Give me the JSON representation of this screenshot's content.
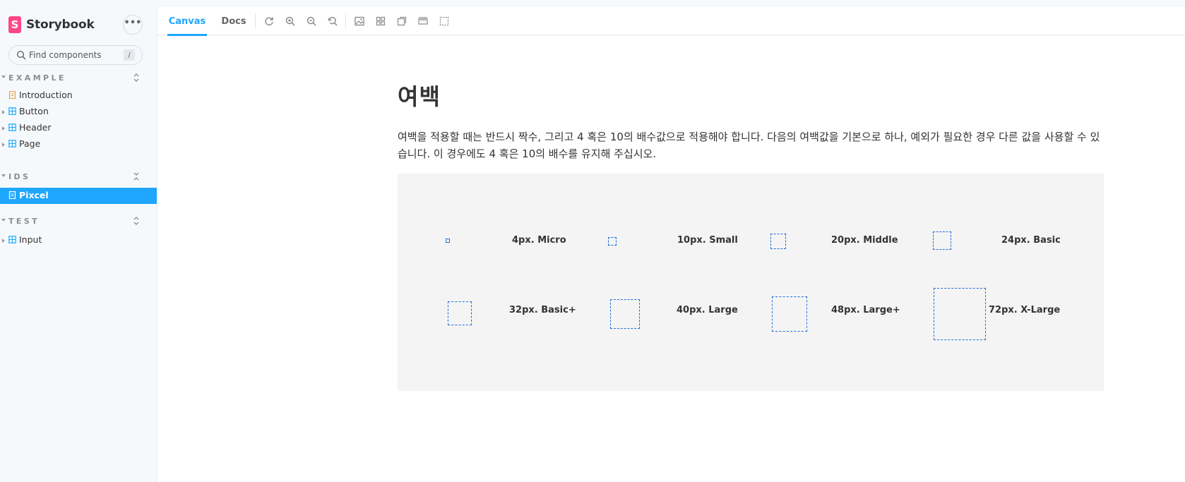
{
  "sidebar": {
    "brand": "Storybook",
    "brand_mark": "S",
    "menu_label": "•••",
    "search": {
      "placeholder": "Find components",
      "shortcut": "/"
    },
    "groups": [
      {
        "title": "EXAMPLE",
        "items": [
          {
            "label": "Introduction",
            "icon": "document-icon",
            "expandable": false
          },
          {
            "label": "Button",
            "icon": "component-icon",
            "expandable": true
          },
          {
            "label": "Header",
            "icon": "component-icon",
            "expandable": true
          },
          {
            "label": "Page",
            "icon": "component-icon",
            "expandable": true
          }
        ]
      },
      {
        "title": "IDS",
        "items": [
          {
            "label": "Pixcel",
            "icon": "document-icon",
            "expandable": false,
            "selected": true
          }
        ]
      },
      {
        "title": "TEST",
        "items": [
          {
            "label": "Input",
            "icon": "component-icon",
            "expandable": true
          }
        ]
      }
    ]
  },
  "toolbar": {
    "tabs": [
      "Canvas",
      "Docs"
    ],
    "active_tab": "Canvas",
    "tools": [
      "reload-icon",
      "zoom-in-icon",
      "zoom-out-icon",
      "zoom-reset-icon",
      "background-icon",
      "grid-icon",
      "viewport-icon",
      "measure-icon",
      "outline-icon"
    ]
  },
  "doc": {
    "title": "여백",
    "description": "여백을 적용할 때는 반드시 짝수, 그리고 4 혹은 10의 배수값으로 적용해야 합니다. 다음의 여백값을 기본으로 하나, 예외가 필요한 경우 다른 값을 사용할 수 있습니다. 이 경우에도 4 혹은 10의 배수를 유지해 주십시오.",
    "spacings": [
      {
        "value": 4,
        "label": "4px. Micro"
      },
      {
        "value": 10,
        "label": "10px. Small"
      },
      {
        "value": 20,
        "label": "20px. Middle"
      },
      {
        "value": 24,
        "label": "24px. Basic"
      },
      {
        "value": 32,
        "label": "32px. Basic+"
      },
      {
        "value": 40,
        "label": "40px. Large"
      },
      {
        "value": 48,
        "label": "48px. Large+"
      },
      {
        "value": 72,
        "label": "72px. X-Large"
      }
    ]
  },
  "colors": {
    "accent": "#1ea7fd",
    "brand": "#ff4785",
    "box_border": "#1f6dd8"
  }
}
